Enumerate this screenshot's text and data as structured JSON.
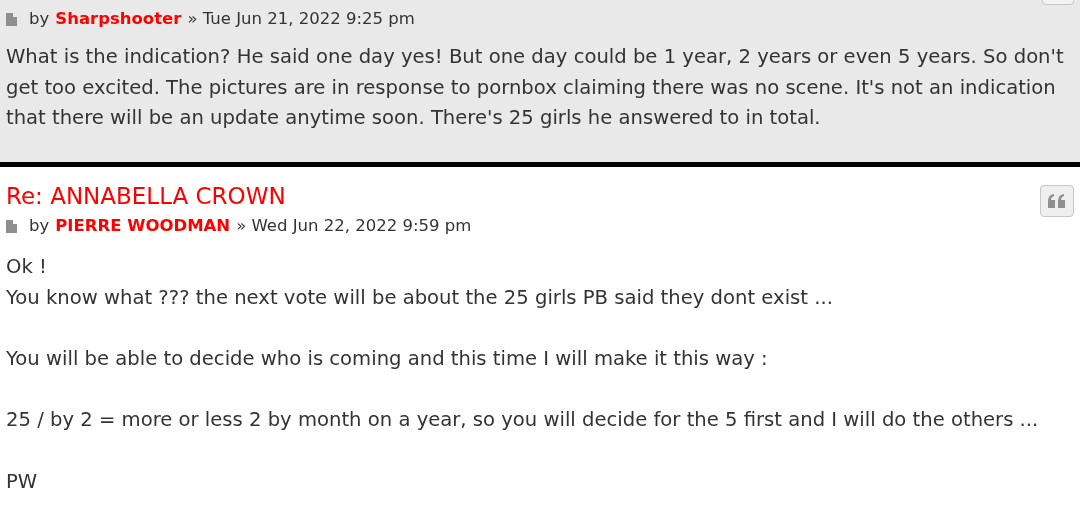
{
  "posts": [
    {
      "author": "Sharpshooter",
      "by": "by",
      "sep": "»",
      "date": "Tue Jun 21, 2022 9:25 pm",
      "highlighted": true,
      "quote_cut": true,
      "paragraphs": [
        [
          "What is the indication? He said one day yes! But one day could be 1 year, 2 years or even 5 years. So don't get too excited. The pictures are in response to pornbox claiming there was no scene. It's not an indication that there will be an update anytime soon. There's 25 girls he answered to in total."
        ]
      ]
    },
    {
      "title": "Re: ANNABELLA CROWN",
      "author": "PIERRE WOODMAN",
      "by": "by",
      "sep": "»",
      "date": "Wed Jun 22, 2022 9:59 pm",
      "highlighted": false,
      "quote_cut": false,
      "paragraphs": [
        [
          "Ok !",
          "You know what ??? the next vote will be about the 25 girls PB said they dont exist ..."
        ],
        [
          "You will be able to decide who is coming and this time I will make it this way :"
        ],
        [
          "25 / by 2 = more or less 2 by month on a year, so you will decide for the 5 first and I will do the others ..."
        ],
        [
          "PW"
        ]
      ]
    }
  ]
}
